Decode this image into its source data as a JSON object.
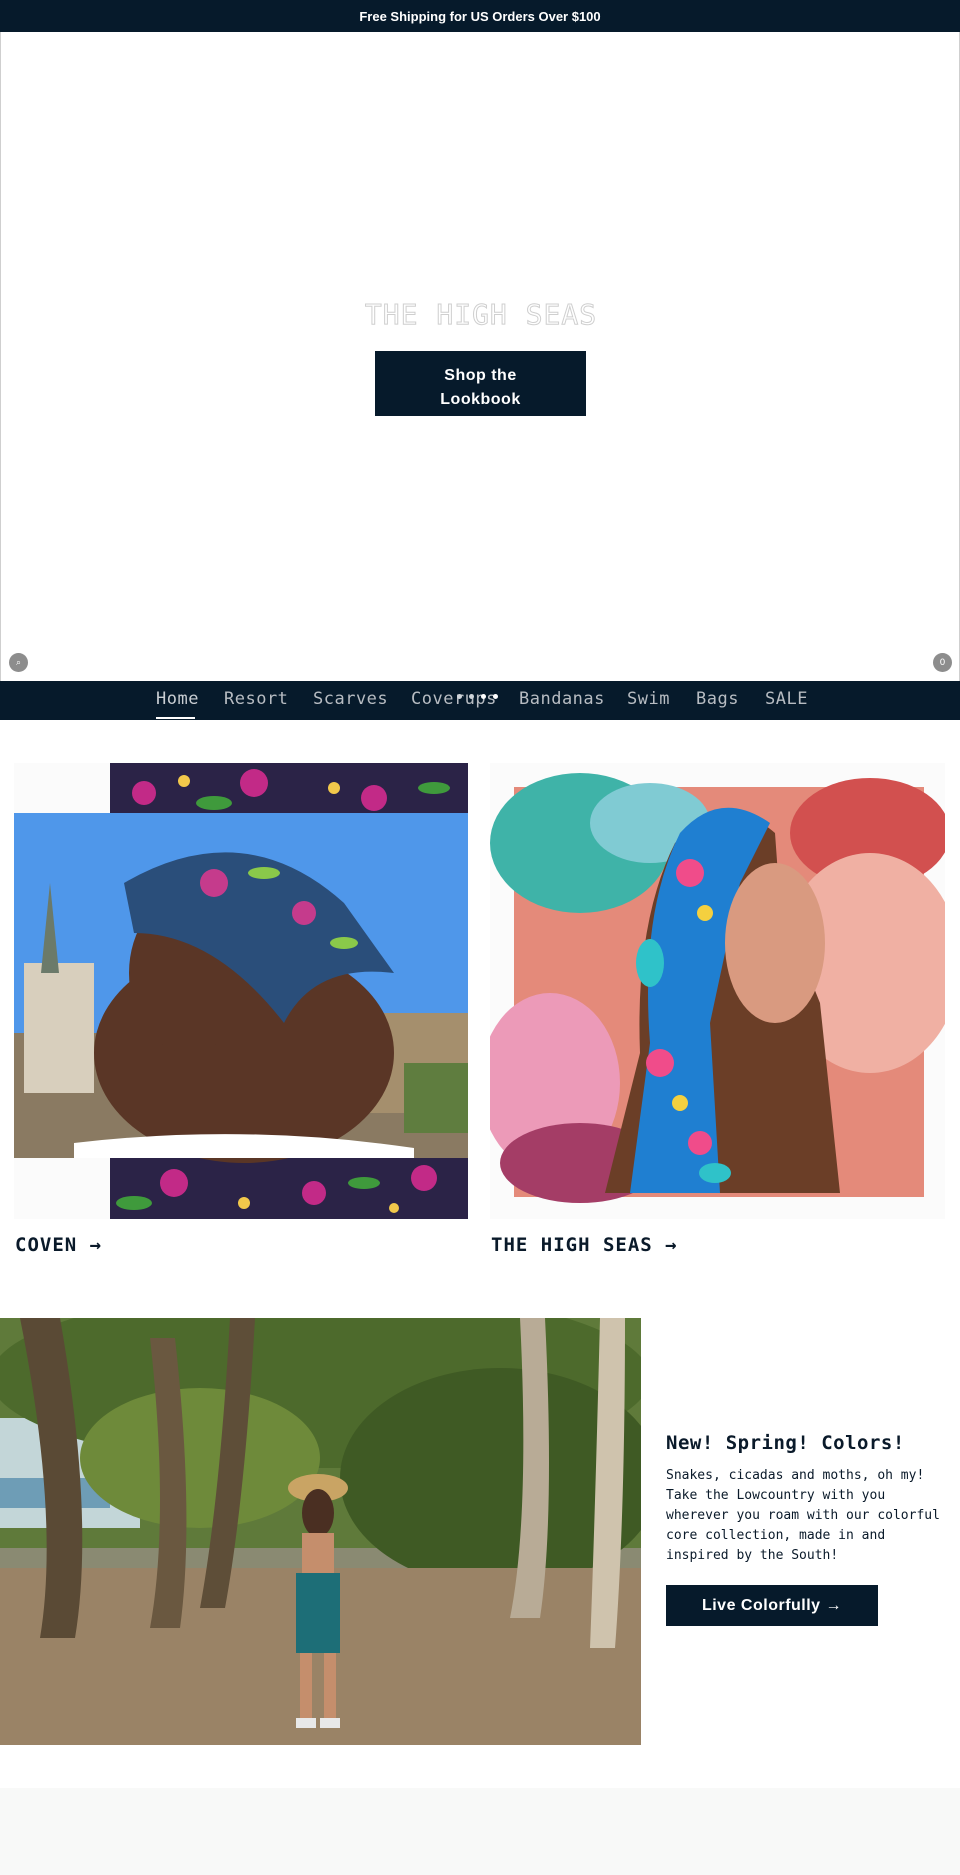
{
  "announcement": {
    "text": "Free Shipping for US Orders Over $100"
  },
  "hero": {
    "title": "THE HIGH SEAS",
    "button_label": "Shop the Lookbook",
    "search_glyph": "⌕",
    "cart_count": "0"
  },
  "nav": {
    "items": [
      {
        "label": "Home",
        "active": true
      },
      {
        "label": "Resort"
      },
      {
        "label": "Scarves"
      },
      {
        "label": "Coverups"
      },
      {
        "label": "Bandanas"
      },
      {
        "label": "Swim"
      },
      {
        "label": "Bags"
      },
      {
        "label": "SALE"
      }
    ]
  },
  "cards": [
    {
      "label": "COVEN →"
    },
    {
      "label": "THE HIGH SEAS →"
    }
  ],
  "feature": {
    "title": "New! Spring! Colors!",
    "body": "Snakes, cicadas and moths, oh my! Take the Lowcountry with you wherever you roam with our colorful core collection, made in and inspired by the South!",
    "button_label": "Live Colorfully →"
  },
  "colors": {
    "navy": "#061a2b",
    "footer_bg": "#f8f9f8"
  }
}
